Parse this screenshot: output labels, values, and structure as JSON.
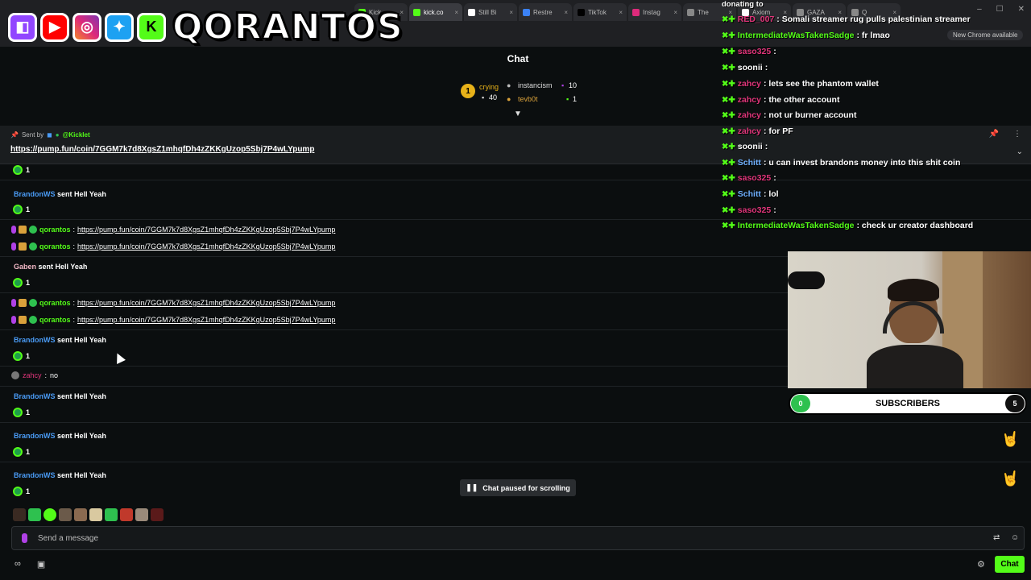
{
  "browser": {
    "tabs": [
      {
        "label": "Kick",
        "color": "#53fc18",
        "active": false
      },
      {
        "label": "kick.co",
        "color": "#53fc18",
        "active": true
      },
      {
        "label": "Still Bi",
        "color": "#ffffff",
        "active": false
      },
      {
        "label": "Restre",
        "color": "#3b82f6",
        "active": false
      },
      {
        "label": "TikTok",
        "color": "#000000",
        "active": false
      },
      {
        "label": "Instag",
        "color": "#dd2a7b",
        "active": false
      },
      {
        "label": "The",
        "color": "#888888",
        "active": false
      },
      {
        "label": "Axiom",
        "color": "#ffffff",
        "active": false
      },
      {
        "label": "GAZA",
        "color": "#888888",
        "active": false
      },
      {
        "label": "Q",
        "color": "#888888",
        "active": false
      }
    ],
    "chrome_update": "New Chrome available"
  },
  "logo": {
    "text": "QORANTOS",
    "icons": [
      "twitch-icon",
      "youtube-icon",
      "instagram-icon",
      "twitter-icon",
      "kick-icon"
    ]
  },
  "chat": {
    "title": "Chat",
    "leaderboard": {
      "first": {
        "name": "crying",
        "count": "40"
      },
      "second": {
        "name": "instancism",
        "count": "10"
      },
      "third": {
        "name": "tevb0t",
        "count": "1"
      }
    },
    "pinned": {
      "sent_by_label": "Sent by",
      "sender": "@Kicklet",
      "link": "https://pump.fun/coin/7GGM7k7d8XgsZ1mhqfDh4zZKKgUzop5Sbj7P4wLYpump"
    },
    "counts": [
      "1",
      "1",
      "1",
      "1",
      "1",
      "1",
      "1"
    ],
    "gifts": [
      {
        "user": "BrandonWS",
        "text": "sent Hell Yeah"
      },
      {
        "user": "Gaben",
        "text": "sent Hell Yeah"
      },
      {
        "user": "BrandonWS",
        "text": "sent Hell Yeah"
      },
      {
        "user": "BrandonWS",
        "text": "sent Hell Yeah"
      },
      {
        "user": "BrandonWS",
        "text": "sent Hell Yeah"
      },
      {
        "user": "BrandonWS",
        "text": "sent Hell Yeah"
      }
    ],
    "link_messages": [
      {
        "user": "qorantos",
        "link": "https://pump.fun/coin/7GGM7k7d8XgsZ1mhqfDh4zZKKgUzop5Sbj7P4wLYpump"
      },
      {
        "user": "qorantos",
        "link": "https://pump.fun/coin/7GGM7k7d8XgsZ1mhqfDh4zZKKgUzop5Sbj7P4wLYpump"
      },
      {
        "user": "qorantos",
        "link": "https://pump.fun/coin/7GGM7k7d8XgsZ1mhqfDh4zZKKgUzop5Sbj7P4wLYpump"
      },
      {
        "user": "qorantos",
        "link": "https://pump.fun/coin/7GGM7k7d8XgsZ1mhqfDh4zZKKgUzop5Sbj7P4wLYpump"
      }
    ],
    "zahcy_message": {
      "user": "zahcy",
      "text": "no"
    },
    "paused_label": "Chat paused for scrolling",
    "input_placeholder": "Send a message",
    "chat_button": "Chat"
  },
  "overlay": {
    "donating": "donating to",
    "lines": [
      {
        "user": "RED_007",
        "color": "#e0357a",
        "text": ": Somali streamer rug pulls palestinian streamer"
      },
      {
        "user": "IntermediateWasTakenSadge",
        "color": "#53fc18",
        "text": ": fr lmao"
      },
      {
        "user": "saso325",
        "color": "#e0357a",
        "text": ":"
      },
      {
        "user": "soonii",
        "color": "#ffffff",
        "text": ":"
      },
      {
        "user": "zahcy",
        "color": "#e0357a",
        "text": ": lets see the phantom wallet"
      },
      {
        "user": "zahcy",
        "color": "#e0357a",
        "text": ": the other account"
      },
      {
        "user": "zahcy",
        "color": "#e0357a",
        "text": ": not ur burner account"
      },
      {
        "user": "zahcy",
        "color": "#e0357a",
        "text": ": for PF"
      },
      {
        "user": "soonii",
        "color": "#ffffff",
        "text": ":"
      },
      {
        "user": "Schitt",
        "color": "#6fb0ff",
        "text": ": u can invest brandons money into this shit coin"
      },
      {
        "user": "saso325",
        "color": "#e0357a",
        "text": ":"
      },
      {
        "user": "Schitt",
        "color": "#6fb0ff",
        "text": ": lol"
      },
      {
        "user": "saso325",
        "color": "#e0357a",
        "text": ":"
      },
      {
        "user": "IntermediateWasTakenSadge",
        "color": "#53fc18",
        "text": ": check ur creator dashboard"
      }
    ]
  },
  "subs": {
    "label": "SUBSCRIBERS",
    "current": "0",
    "goal": "5"
  }
}
